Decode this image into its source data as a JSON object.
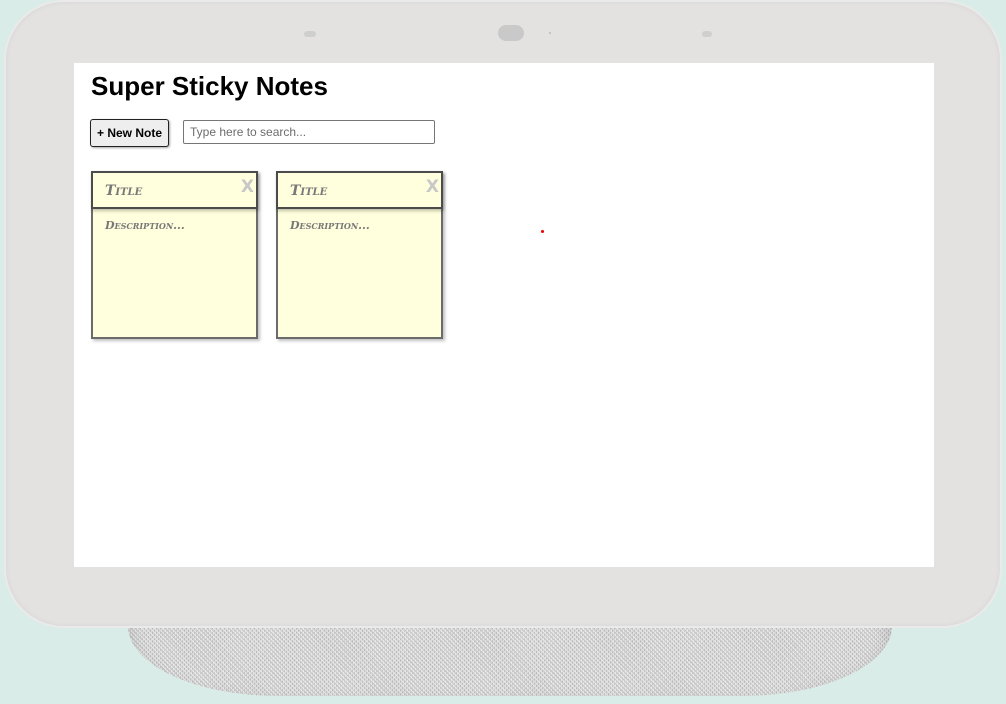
{
  "app": {
    "title": "Super Sticky Notes"
  },
  "toolbar": {
    "new_note_label": "+ New Note",
    "search_placeholder": "Type here to search..."
  },
  "notes": [
    {
      "title": "Title",
      "description": "Description...",
      "close_label": "X"
    },
    {
      "title": "Title",
      "description": "Description...",
      "close_label": "X"
    }
  ],
  "colors": {
    "note_background": "#ffffdd",
    "screen_background": "#ffffff",
    "bezel": "#e3e2e1",
    "page_background": "#d9ece7"
  }
}
